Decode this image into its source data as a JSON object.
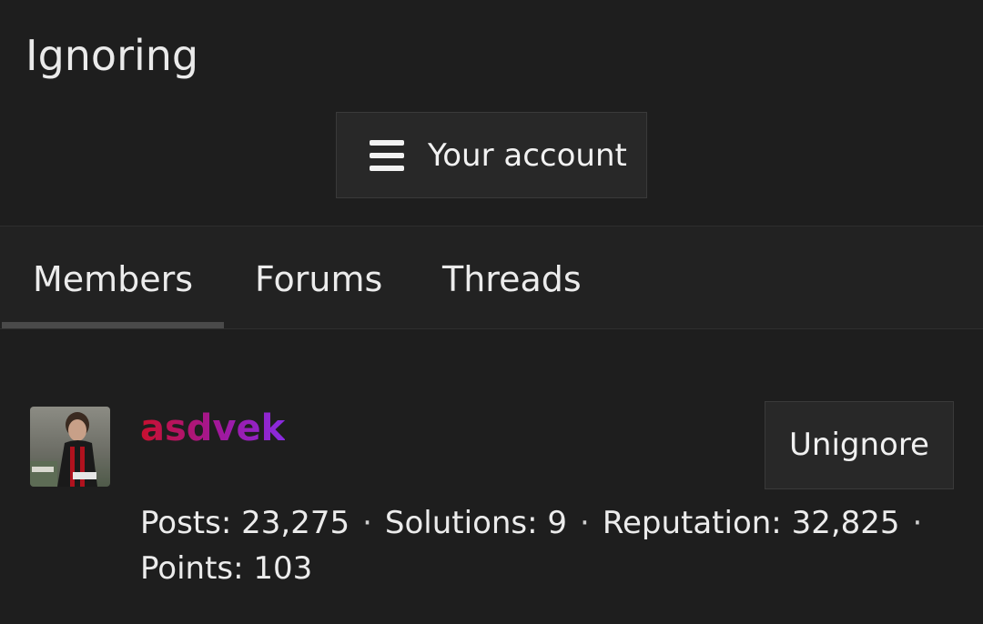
{
  "page": {
    "title": "Ignoring"
  },
  "account_menu": {
    "label": "Your account",
    "icon": "hamburger-menu-icon"
  },
  "tabs": [
    {
      "label": "Members",
      "active": true
    },
    {
      "label": "Forums",
      "active": false
    },
    {
      "label": "Threads",
      "active": false
    }
  ],
  "ignored_members": [
    {
      "username": "asdvek",
      "username_gradient": [
        "#c8102e",
        "#a0189c",
        "#8a2be2"
      ],
      "unignore_label": "Unignore",
      "stats": {
        "posts_label": "Posts:",
        "posts": "23,275",
        "solutions_label": "Solutions:",
        "solutions": "9",
        "reputation_label": "Reputation:",
        "reputation": "32,825",
        "points_label": "Points:",
        "points": "103",
        "separator": "·"
      }
    }
  ],
  "colors": {
    "background": "#1e1e1e",
    "button_bg": "#282828",
    "tab_bar_bg": "#222222",
    "active_tab_underline": "#4a4a4a",
    "text": "#f0f0f0"
  }
}
